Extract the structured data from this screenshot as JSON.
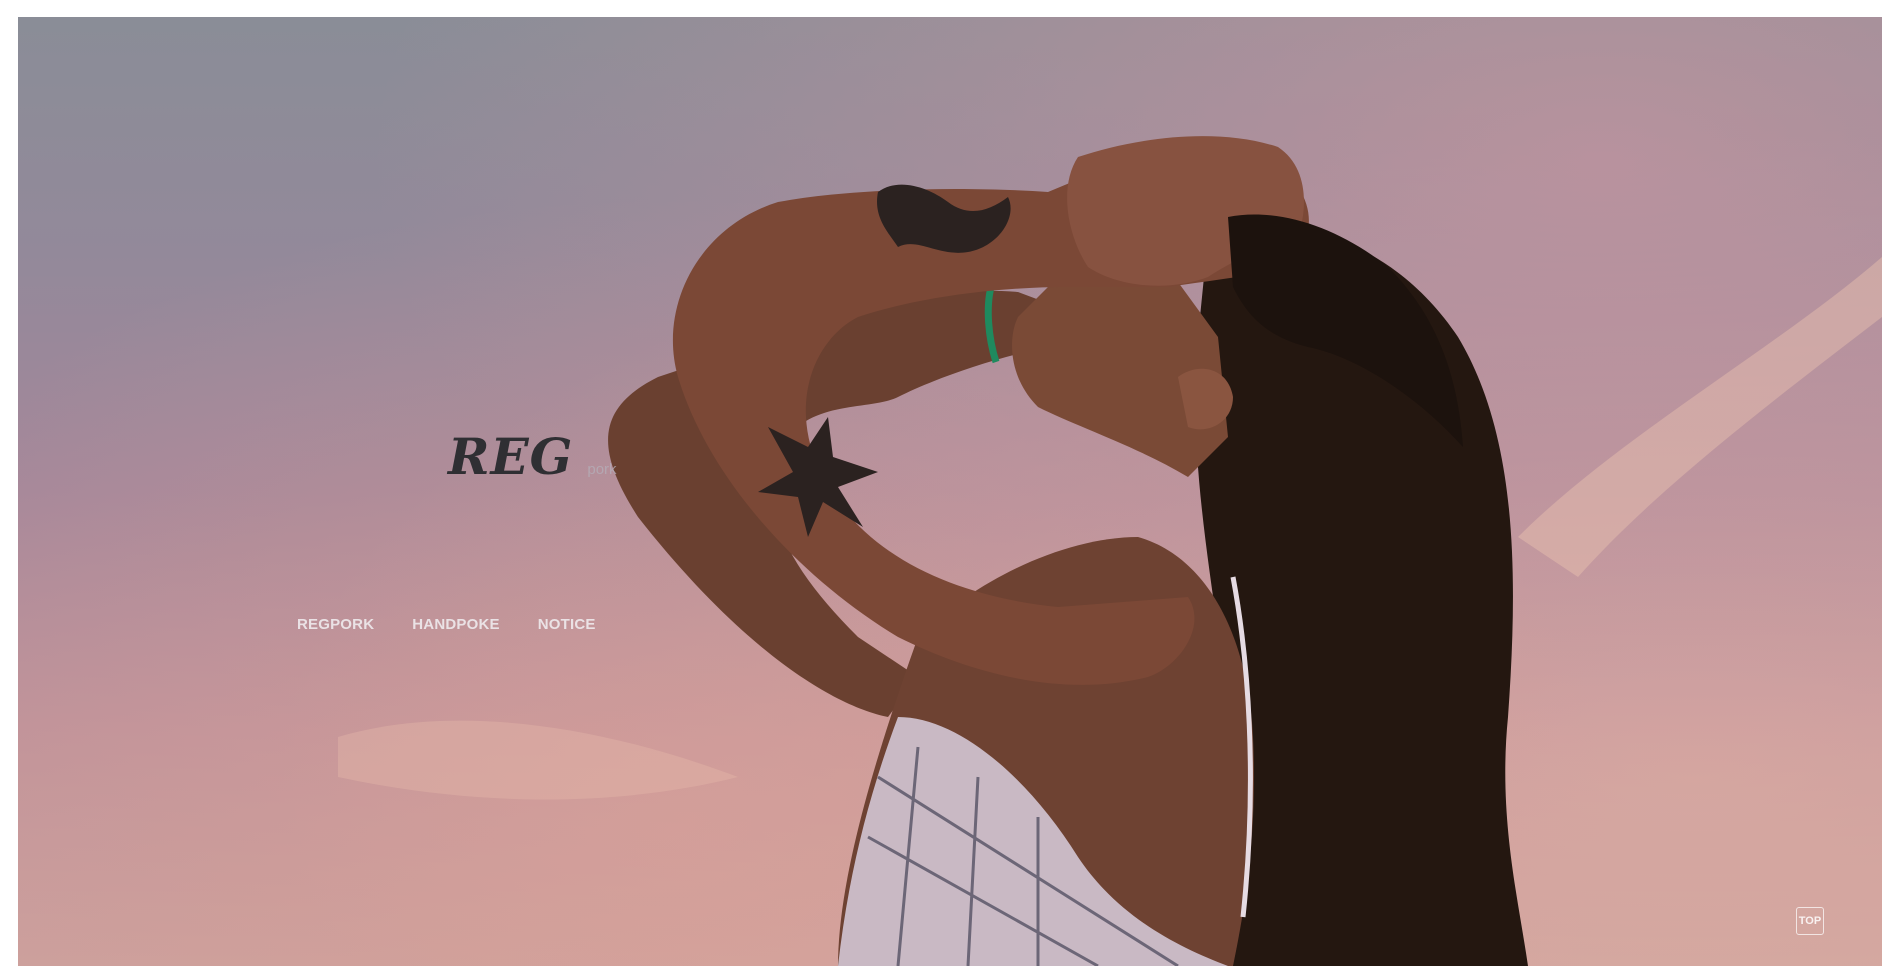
{
  "brand": {
    "logo_main": "REG",
    "logo_sub": "pork"
  },
  "nav": {
    "items": [
      {
        "label": "REGPORK"
      },
      {
        "label": "HANDPOKE"
      },
      {
        "label": "NOTICE"
      }
    ]
  },
  "scroll_top": {
    "label": "TOP"
  },
  "colors": {
    "sky_top": "#8a8d97",
    "sky_bottom": "#caa09d",
    "logo_text": "#2f2f33",
    "nav_text": "#eee8ec"
  },
  "icons": {
    "hero_image": "woman-profile-looking-up-photo"
  }
}
